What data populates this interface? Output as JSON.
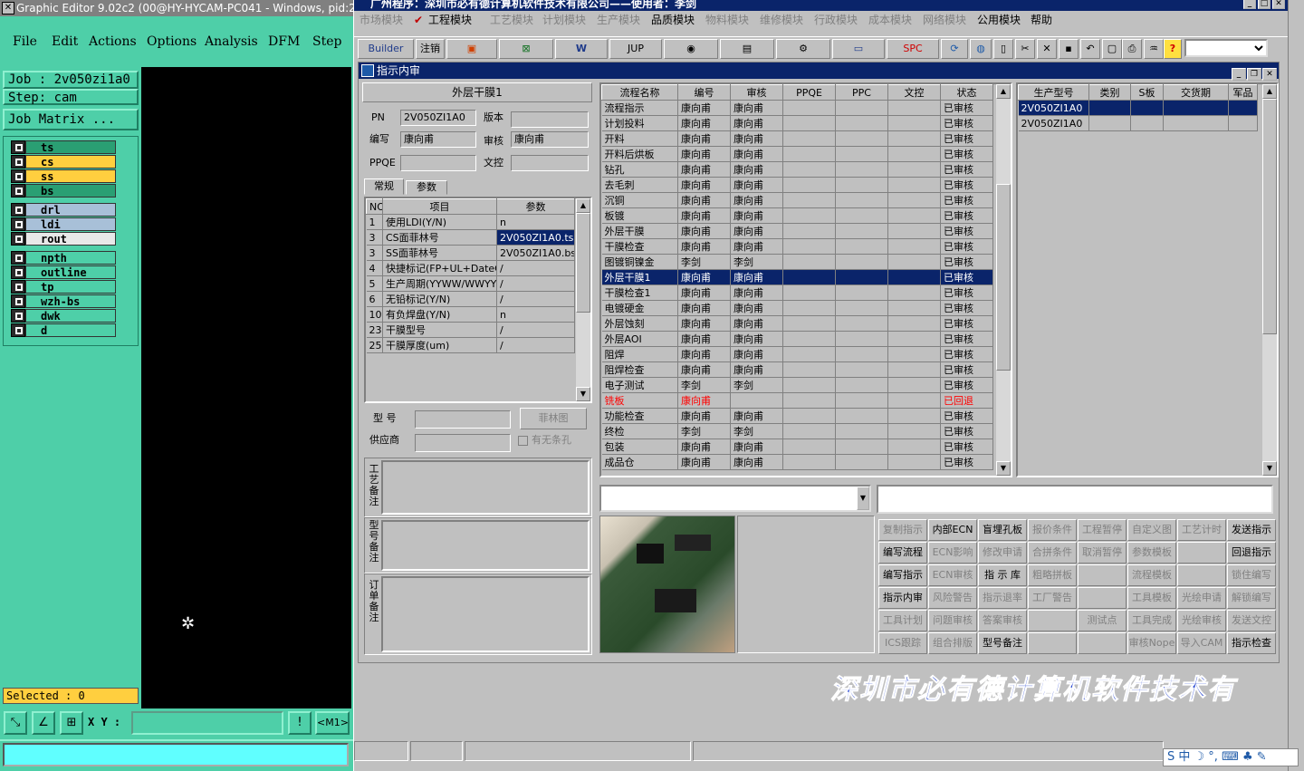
{
  "ge": {
    "title": "Graphic Editor 9.02c2 (00@HY-HYCAM-PC041 - Windows, pid:2128",
    "menu": [
      "File",
      "Edit",
      "Actions",
      "Options",
      "Analysis",
      "DFM",
      "Step"
    ],
    "job": "Job : 2v050zi1a0",
    "step": "Step: cam",
    "job_matrix": "Job Matrix ...",
    "layers": [
      {
        "name": "ts",
        "color": "#2a9f73"
      },
      {
        "name": "cs",
        "color": "#ffcf3f"
      },
      {
        "name": "ss",
        "color": "#ffcf3f"
      },
      {
        "name": "bs",
        "color": "#2a9f73"
      },
      {
        "name": "drl",
        "color": "#a8c0d8"
      },
      {
        "name": "ldi",
        "color": "#a8c0d8"
      },
      {
        "name": "rout",
        "color": "#e8e8e8"
      },
      {
        "name": "npth",
        "color": "#4ecfa8"
      },
      {
        "name": "outline",
        "color": "#4ecfa8"
      },
      {
        "name": "tp",
        "color": "#4ecfa8"
      },
      {
        "name": "wzh-bs",
        "color": "#4ecfa8"
      },
      {
        "name": "dwk",
        "color": "#4ecfa8"
      },
      {
        "name": "d",
        "color": "#4ecfa8"
      }
    ],
    "selected": "Selected : 0",
    "xy_label": "X Y :",
    "xy_value": "",
    "m1": "<M1>"
  },
  "app": {
    "title": "广州程序：深圳市必有德计算机软件技术有限公司——使用者：李剑",
    "menu": [
      {
        "label": "市场模块",
        "dim": true
      },
      {
        "label": "工程模块",
        "dim": false
      },
      {
        "label": "工艺模块",
        "dim": true
      },
      {
        "label": "计划模块",
        "dim": true
      },
      {
        "label": "生产模块",
        "dim": true
      },
      {
        "label": "品质模块",
        "dim": false
      },
      {
        "label": "物料模块",
        "dim": true
      },
      {
        "label": "维修模块",
        "dim": true
      },
      {
        "label": "行政模块",
        "dim": true
      },
      {
        "label": "成本模块",
        "dim": true
      },
      {
        "label": "网络模块",
        "dim": true
      },
      {
        "label": "公用模块",
        "dim": false
      },
      {
        "label": "帮助",
        "dim": false
      }
    ],
    "toolbar": {
      "builder": "Builder",
      "logout": "注销",
      "jup": "JUP",
      "spc": "SPC"
    },
    "window_title": "指示内审",
    "panel_title": "外层干膜1",
    "form": {
      "pn_label": "PN",
      "pn": "2V050ZI1A0",
      "version_label": "版本",
      "version": "",
      "writer_label": "编写",
      "writer": "康向甫",
      "review_label": "审核",
      "reviewer": "康向甫",
      "ppqe_label": "PPQE",
      "ppqe": "",
      "doc_label": "文控",
      "doc": ""
    },
    "tabs": [
      "常规",
      "参数"
    ],
    "params_headers": [
      "NO",
      "项目",
      "参数"
    ],
    "params": [
      {
        "no": "1",
        "item": "使用LDI(Y/N)",
        "val": "n"
      },
      {
        "no": "3",
        "item": "CS面菲林号",
        "val": "2V050ZI1A0.ts"
      },
      {
        "no": "3",
        "item": "SS面菲林号",
        "val": "2V050ZI1A0.bs"
      },
      {
        "no": "4",
        "item": "快捷标记(FP+UL+DateC",
        "val": "/"
      },
      {
        "no": "5",
        "item": "生产周期(YYWW/WWYY)",
        "val": "/"
      },
      {
        "no": "6",
        "item": "无铅标记(Y/N)",
        "val": "/"
      },
      {
        "no": "10",
        "item": "有负焊盘(Y/N)",
        "val": "n"
      },
      {
        "no": "23",
        "item": "干膜型号",
        "val": "/"
      },
      {
        "no": "25",
        "item": "干膜厚度(um)",
        "val": "/"
      }
    ],
    "model_label": "型  号",
    "supplier_label": "供应商",
    "film_btn": "菲林图",
    "no_strip_label": "有无条孔",
    "memo_labels": [
      "工艺备注",
      "型号备注",
      "订单备注"
    ],
    "flow_headers": [
      "流程名称",
      "编号",
      "审核",
      "PPQE",
      "PPC",
      "文控",
      "状态"
    ],
    "flows": [
      {
        "name": "流程指示",
        "w": "康向甫",
        "r": "康向甫",
        "s": "已审核"
      },
      {
        "name": "计划投料",
        "w": "康向甫",
        "r": "康向甫",
        "s": "已审核"
      },
      {
        "name": "开料",
        "w": "康向甫",
        "r": "康向甫",
        "s": "已审核"
      },
      {
        "name": "开料后烘板",
        "w": "康向甫",
        "r": "康向甫",
        "s": "已审核"
      },
      {
        "name": "钻孔",
        "w": "康向甫",
        "r": "康向甫",
        "s": "已审核"
      },
      {
        "name": "去毛刺",
        "w": "康向甫",
        "r": "康向甫",
        "s": "已审核"
      },
      {
        "name": "沉铜",
        "w": "康向甫",
        "r": "康向甫",
        "s": "已审核"
      },
      {
        "name": "板镀",
        "w": "康向甫",
        "r": "康向甫",
        "s": "已审核"
      },
      {
        "name": "外层干膜",
        "w": "康向甫",
        "r": "康向甫",
        "s": "已审核"
      },
      {
        "name": "干膜检查",
        "w": "康向甫",
        "r": "康向甫",
        "s": "已审核"
      },
      {
        "name": "图镀铜镍金",
        "w": "李剑",
        "r": "李剑",
        "s": "已审核"
      },
      {
        "name": "外层干膜1",
        "w": "康向甫",
        "r": "康向甫",
        "s": "已审核",
        "sel": true
      },
      {
        "name": "干膜检查1",
        "w": "康向甫",
        "r": "康向甫",
        "s": "已审核"
      },
      {
        "name": "电镀硬金",
        "w": "康向甫",
        "r": "康向甫",
        "s": "已审核"
      },
      {
        "name": "外层蚀刻",
        "w": "康向甫",
        "r": "康向甫",
        "s": "已审核"
      },
      {
        "name": "外层AOI",
        "w": "康向甫",
        "r": "康向甫",
        "s": "已审核"
      },
      {
        "name": "阻焊",
        "w": "康向甫",
        "r": "康向甫",
        "s": "已审核"
      },
      {
        "name": "阻焊检查",
        "w": "康向甫",
        "r": "康向甫",
        "s": "已审核"
      },
      {
        "name": "电子测试",
        "w": "李剑",
        "r": "李剑",
        "s": "已审核"
      },
      {
        "name": "铣板",
        "w": "康向甫",
        "r": "",
        "s": "已回退",
        "red": true
      },
      {
        "name": "功能检查",
        "w": "康向甫",
        "r": "康向甫",
        "s": "已审核"
      },
      {
        "name": "终检",
        "w": "李剑",
        "r": "李剑",
        "s": "已审核"
      },
      {
        "name": "包装",
        "w": "康向甫",
        "r": "康向甫",
        "s": "已审核"
      },
      {
        "name": "成品仓",
        "w": "康向甫",
        "r": "康向甫",
        "s": "已审核"
      }
    ],
    "prod_headers": [
      "生产型号",
      "类别",
      "S板",
      "交货期",
      "军品"
    ],
    "prods": [
      {
        "pn": "2V050ZI1A0",
        "sel": true
      },
      {
        "pn": "2V050ZI1A0",
        "sel": false
      }
    ],
    "buttons": [
      [
        {
          "l": "复制指示",
          "d": true
        },
        {
          "l": "内部ECN",
          "d": false
        },
        {
          "l": "盲埋孔板",
          "d": false
        },
        {
          "l": "报价条件",
          "d": true
        },
        {
          "l": "工程暂停",
          "d": true
        },
        {
          "l": "自定义图",
          "d": true
        },
        {
          "l": "工艺计时",
          "d": true
        },
        {
          "l": "发送指示",
          "d": false
        }
      ],
      [
        {
          "l": "编写流程",
          "d": false
        },
        {
          "l": "ECN影响",
          "d": true
        },
        {
          "l": "修改申请",
          "d": true
        },
        {
          "l": "合拼条件",
          "d": true
        },
        {
          "l": "取消暂停",
          "d": true
        },
        {
          "l": "参数模板",
          "d": true
        },
        {
          "l": "",
          "d": true
        },
        {
          "l": "回退指示",
          "d": false
        }
      ],
      [
        {
          "l": "编写指示",
          "d": false
        },
        {
          "l": "ECN审核",
          "d": true
        },
        {
          "l": "指 示 库",
          "d": false
        },
        {
          "l": "粗略拼板",
          "d": true
        },
        {
          "l": "",
          "d": true
        },
        {
          "l": "流程模板",
          "d": true
        },
        {
          "l": "",
          "d": true
        },
        {
          "l": "锁住编写",
          "d": true
        }
      ],
      [
        {
          "l": "指示内审",
          "d": false
        },
        {
          "l": "风险警告",
          "d": true
        },
        {
          "l": "指示退率",
          "d": true
        },
        {
          "l": "工厂警告",
          "d": true
        },
        {
          "l": "",
          "d": true
        },
        {
          "l": "工具模板",
          "d": true
        },
        {
          "l": "光绘申请",
          "d": true
        },
        {
          "l": "解锁编写",
          "d": true
        }
      ],
      [
        {
          "l": "工具计划",
          "d": true
        },
        {
          "l": "问题审核",
          "d": true
        },
        {
          "l": "答案审核",
          "d": true
        },
        {
          "l": "",
          "d": true
        },
        {
          "l": "测试点",
          "d": true
        },
        {
          "l": "工具完成",
          "d": true
        },
        {
          "l": "光绘审核",
          "d": true
        },
        {
          "l": "发送文控",
          "d": true
        }
      ],
      [
        {
          "l": "ICS跟踪",
          "d": true
        },
        {
          "l": "组合排版",
          "d": true
        },
        {
          "l": "型号备注",
          "d": false
        },
        {
          "l": "",
          "d": true
        },
        {
          "l": "",
          "d": true
        },
        {
          "l": "审核Nope",
          "d": true
        },
        {
          "l": "导入CAM",
          "d": true
        },
        {
          "l": "指示检查",
          "d": false
        }
      ]
    ],
    "banner": "深圳市必有德计算机软件技术有",
    "ime": "S 中 ☽ °, ⌨ ♣ ✎"
  }
}
